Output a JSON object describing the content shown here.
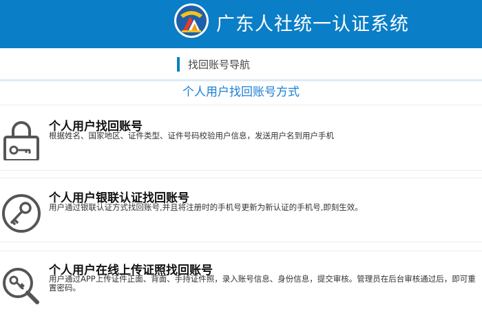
{
  "header": {
    "title": "广东人社统一认证系统",
    "logo_icon": "guangdong-hrss-emblem",
    "background_color": "#0a7ec6"
  },
  "nav": {
    "label": "找回账号导航"
  },
  "section": {
    "title": "个人用户找回账号方式"
  },
  "options": [
    {
      "icon": "lock-icon",
      "title": "个人用户找回账号",
      "desc": "根据姓名、国家地区、证件类型、证件号码校验用户信息，发送用户名到用户手机"
    },
    {
      "icon": "key-icon",
      "title": "个人用户银联认证找回账号",
      "desc": "用户通过银联认证方式找回账号,并且将注册时的手机号更新为新认证的手机号,即刻生效。"
    },
    {
      "icon": "search-key-icon",
      "title": "个人用户在线上传证照找回账号",
      "desc": "用户通过APP上传证件正面、背面、手持证件照，录入账号信息、身份信息，提交审核。管理员在后台审核通过后，即可重置密码。"
    }
  ],
  "colors": {
    "accent": "#0a7ec6",
    "section_title": "#1a7fd4",
    "icon_gray": "#555555"
  }
}
